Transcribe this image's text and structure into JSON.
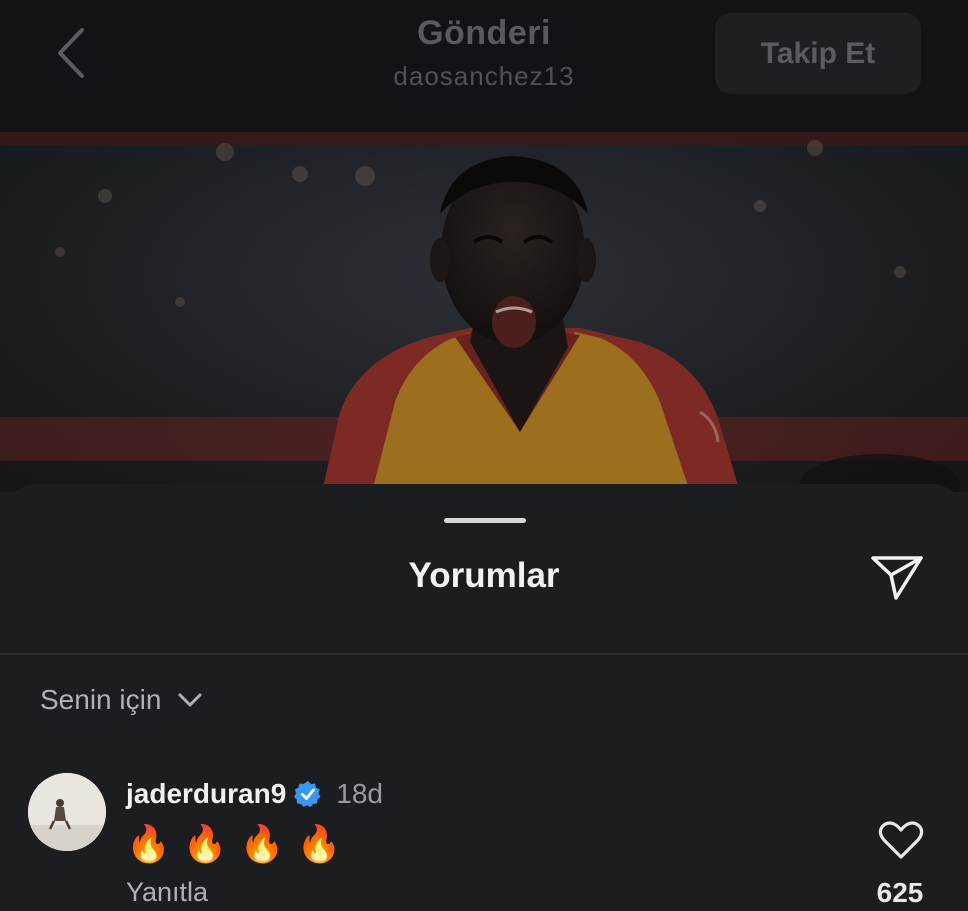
{
  "header": {
    "title": "Gönderi",
    "subtitle": "daosanchez13",
    "follow_label": "Takip Et"
  },
  "comments_sheet": {
    "title": "Yorumlar",
    "filter_label": "Senin için"
  },
  "comment": {
    "username": "jaderduran9",
    "time": "18d",
    "emojis": [
      "🔥",
      "🔥",
      "🔥",
      "🔥"
    ],
    "reply_label": "Yanıtla",
    "like_count": "625"
  },
  "icons": {
    "back": "chevron-left-icon",
    "send": "send-icon",
    "filter": "chevron-down-icon",
    "verified": "verified-badge-icon",
    "like": "heart-icon"
  },
  "colors": {
    "background": "#1c1d20",
    "topbar": "#121316",
    "verified": "#3897f0",
    "jersey_red": "#7d2a25",
    "jersey_yellow": "#a37a1f"
  }
}
